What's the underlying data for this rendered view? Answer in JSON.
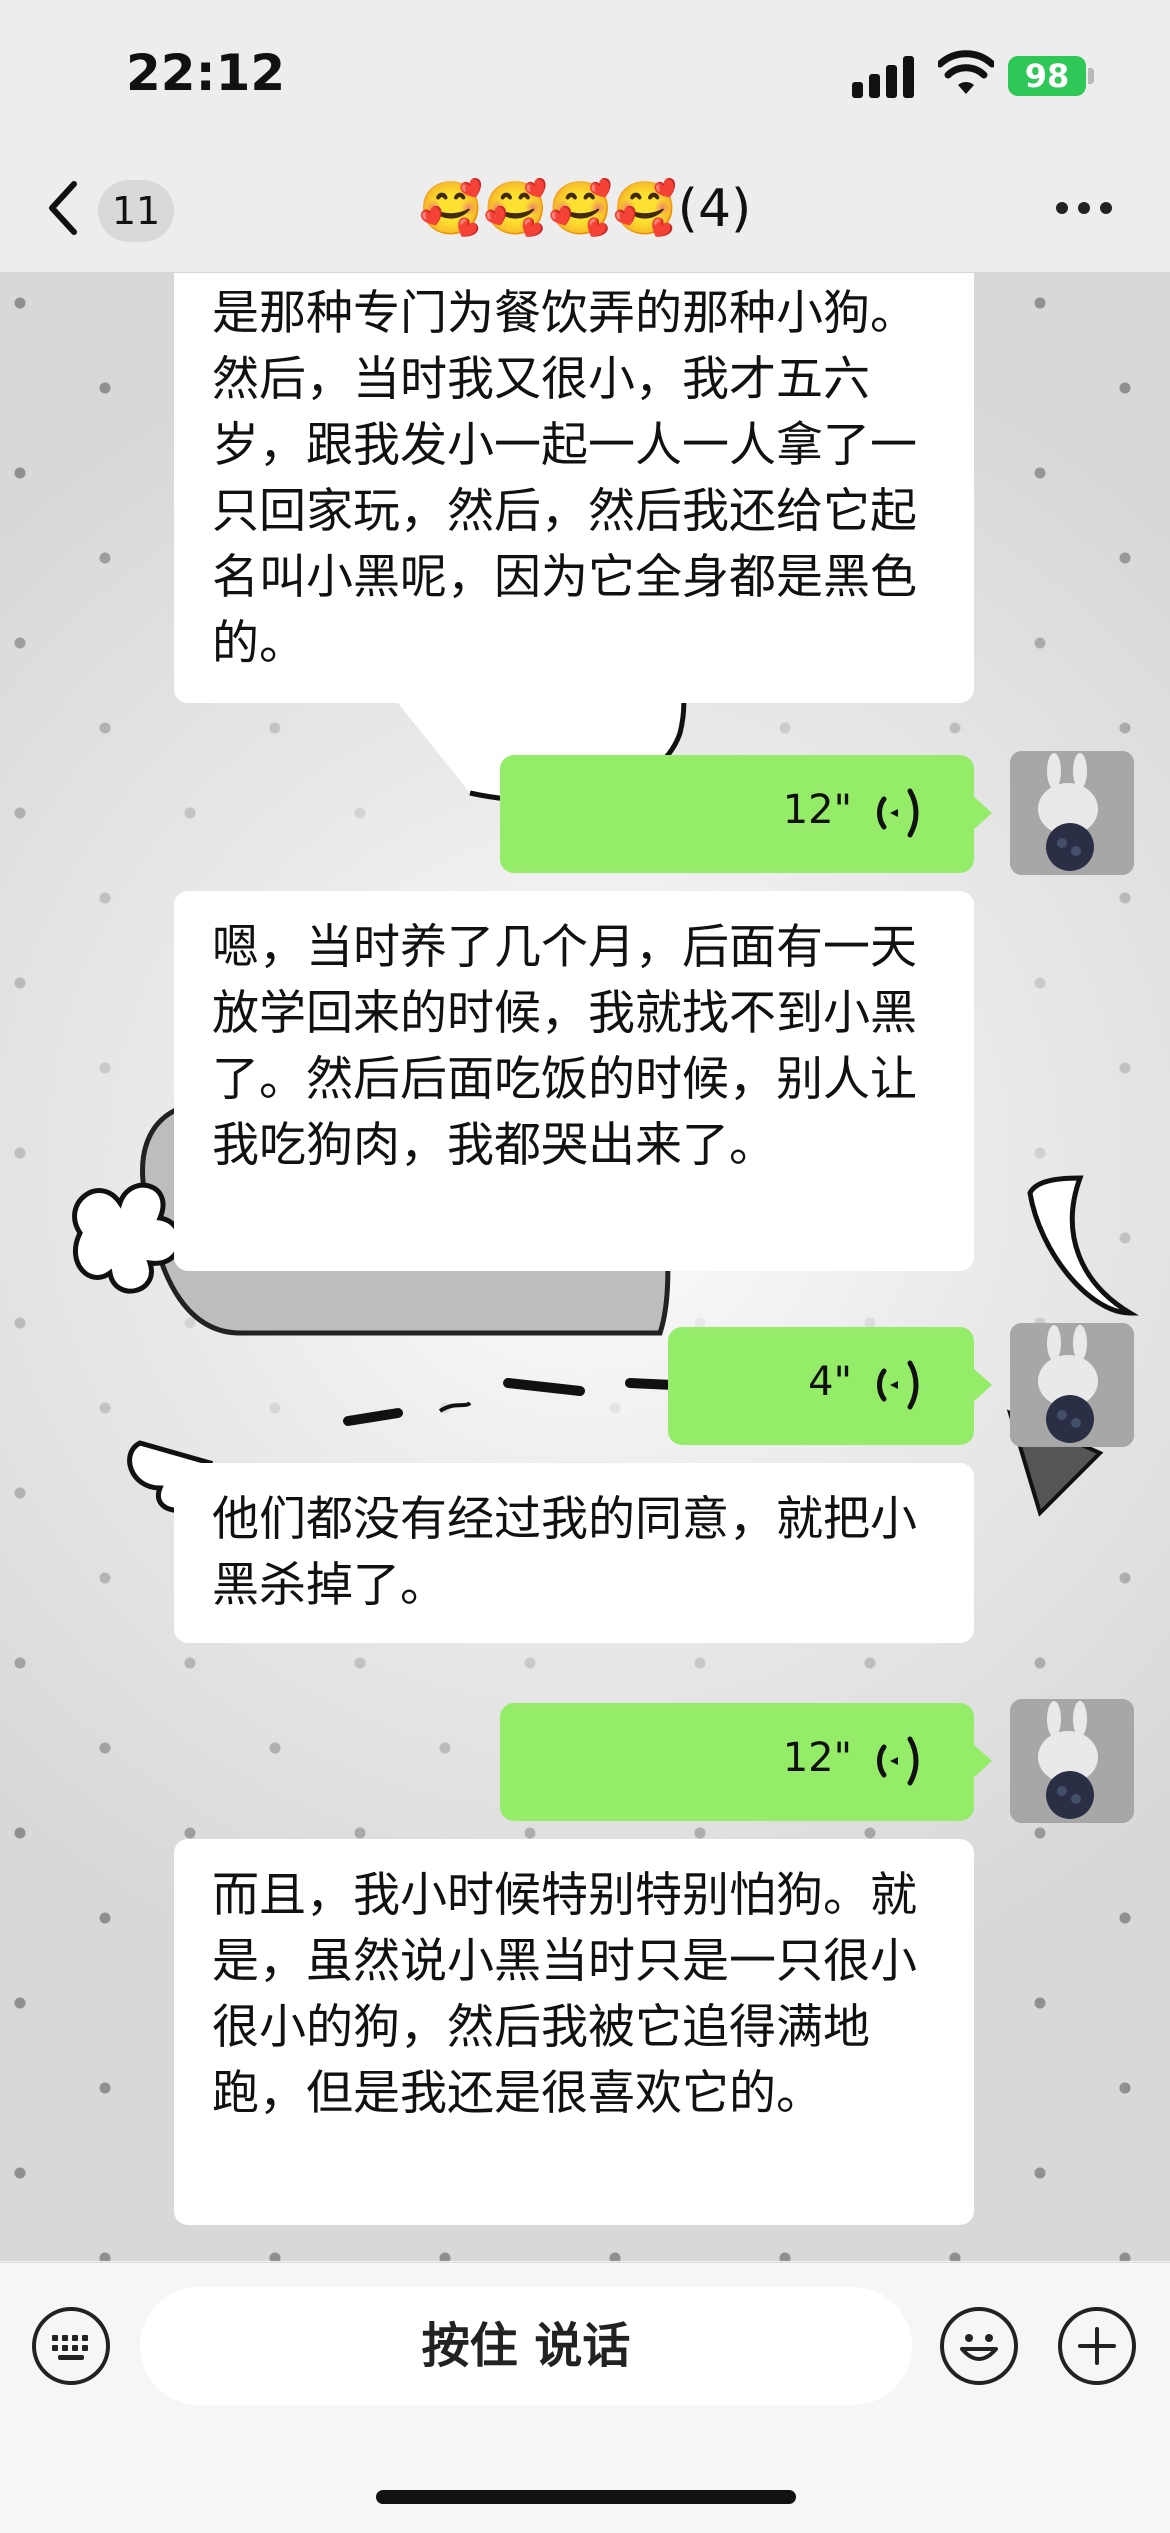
{
  "status_bar": {
    "time": "22:12",
    "battery": "98"
  },
  "nav": {
    "unread_count": "11",
    "title": "🥰🥰🥰🥰(4)"
  },
  "messages": [
    {
      "type": "text",
      "direction": "incoming",
      "text": "是那种专门为餐饮弄的那种小狗。然后，当时我又很小，我才五六岁，跟我发小一起一人一人拿了一只回家玩，然后，然后我还给它起名叫小黑呢，因为它全身都是黑色的。"
    },
    {
      "type": "voice",
      "direction": "outgoing",
      "duration": "12\""
    },
    {
      "type": "text",
      "direction": "incoming",
      "text": "嗯，当时养了几个月，后面有一天放学回来的时候，我就找不到小黑了。然后后面吃饭的时候，别人让我吃狗肉，我都哭出来了。"
    },
    {
      "type": "voice",
      "direction": "outgoing",
      "duration": "4\""
    },
    {
      "type": "text",
      "direction": "incoming",
      "text": "他们都没有经过我的同意，就把小黑杀掉了。"
    },
    {
      "type": "voice",
      "direction": "outgoing",
      "duration": "12\""
    },
    {
      "type": "text",
      "direction": "incoming",
      "text": "而且，我小时候特别特别怕狗。就是，虽然说小黑当时只是一只很小很小的狗，然后我被它追得满地跑，但是我还是很喜欢它的。"
    }
  ],
  "input_bar": {
    "hold_to_talk": "按住 说话"
  },
  "icons": [
    "back-chevron-icon",
    "more-icon",
    "keyboard-icon",
    "emoji-icon",
    "plus-icon",
    "voice-wave-icon"
  ],
  "colors": {
    "outgoing_bubble": "#95ec69",
    "incoming_bubble": "#ffffff",
    "battery": "#30c759"
  }
}
